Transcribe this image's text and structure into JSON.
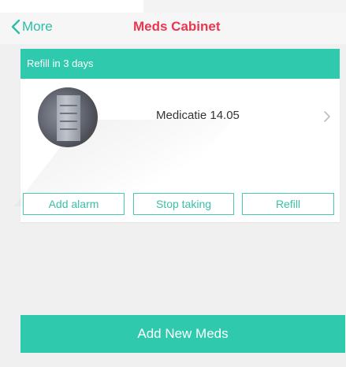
{
  "nav": {
    "back_label": "More",
    "title": "Meds Cabinet"
  },
  "card": {
    "banner": "Refill in 3 days",
    "medication_name": "Medicatie 14.05",
    "actions": {
      "add_alarm": "Add alarm",
      "stop_taking": "Stop taking",
      "refill": "Refill"
    }
  },
  "footer": {
    "add_button": "Add New Meds"
  },
  "colors": {
    "accent": "#2fc9ad",
    "title_red": "#e8384f",
    "background": "#f0f0f0"
  },
  "icons": {
    "back": "chevron-left-icon",
    "row": "chevron-right-icon"
  }
}
